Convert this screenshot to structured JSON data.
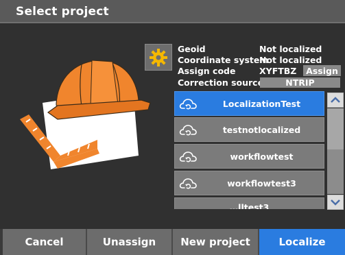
{
  "window": {
    "title": "Select project"
  },
  "details": {
    "geoid_label": "Geoid",
    "geoid_value": "Not localized",
    "coord_label": "Coordinate system",
    "coord_value": "Not localized",
    "assign_code_label": "Assign code",
    "assign_code_value": "XYFTBZ",
    "assign_button": "Assign",
    "correction_label": "Correction source",
    "correction_value": "NTRIP"
  },
  "projects": [
    {
      "name": "LocalizationTest",
      "selected": true
    },
    {
      "name": "testnotlocalized",
      "selected": false
    },
    {
      "name": "workflowtest",
      "selected": false
    },
    {
      "name": "workflowtest3",
      "selected": false
    },
    {
      "name": "…lltest3",
      "selected": false
    }
  ],
  "buttons": {
    "cancel": "Cancel",
    "unassign": "Unassign",
    "new_project": "New project",
    "localize": "Localize"
  },
  "icons": {
    "settings": "gear-icon",
    "project": "cloud-sync-icon",
    "scroll_up": "chevron-up-icon",
    "scroll_down": "chevron-down-icon"
  },
  "colors": {
    "accent": "#2a7ce0",
    "helmet": "#f0852d",
    "gear": "#f5b800"
  }
}
